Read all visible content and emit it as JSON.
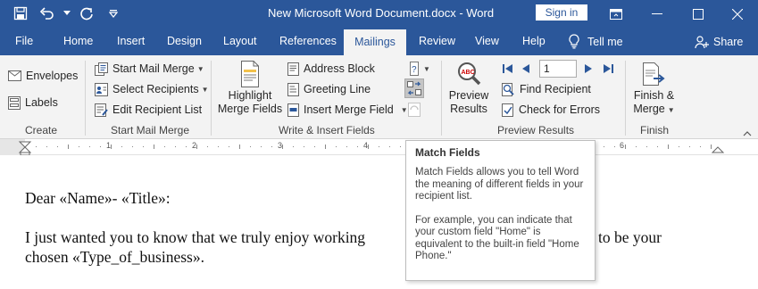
{
  "window": {
    "title": "New Microsoft Word Document.docx  -  Word",
    "sign_in": "Sign in"
  },
  "tabs": [
    "File",
    "Home",
    "Insert",
    "Design",
    "Layout",
    "References",
    "Mailings",
    "Review",
    "View",
    "Help"
  ],
  "active_tab": "Mailings",
  "tell_me": "Tell me",
  "share": "Share",
  "ribbon": {
    "create": {
      "label": "Create",
      "envelopes": "Envelopes",
      "labels": "Labels"
    },
    "start_mail_merge": {
      "label": "Start Mail Merge",
      "start": "Start Mail Merge",
      "select_recipients": "Select Recipients",
      "edit_list": "Edit Recipient List"
    },
    "write_insert": {
      "label": "Write & Insert Fields",
      "highlight_line1": "Highlight",
      "highlight_line2": "Merge Fields",
      "address_block": "Address Block",
      "greeting_line": "Greeting Line",
      "insert_merge_field": "Insert Merge Field"
    },
    "preview": {
      "label": "Preview Results",
      "preview_line1": "Preview",
      "preview_line2": "Results",
      "record_number": "1",
      "find_recipient": "Find Recipient",
      "check_errors": "Check for Errors"
    },
    "finish": {
      "label": "Finish",
      "finish_line1": "Finish &",
      "finish_line2": "Merge"
    }
  },
  "ruler_numbers": [
    "1",
    "2",
    "3",
    "4",
    "5",
    "6"
  ],
  "document": {
    "line1": "Dear «Name»- «Title»:",
    "line2_left": "I just wanted you to know that we truly enjoy working",
    "line2_right": "to be your",
    "line3": "chosen «Type_of_business»."
  },
  "tooltip": {
    "title": "Match Fields",
    "para1": "Match Fields allows you to tell Word the meaning of different fields in your recipient list.",
    "para2": "For example, you can indicate that your custom field \"Home\" is equivalent to the built-in field \"Home Phone.\""
  },
  "colors": {
    "brand": "#2b579a",
    "ribbon_bg": "#f3f3f3",
    "accent_icon": "#2b579a"
  }
}
